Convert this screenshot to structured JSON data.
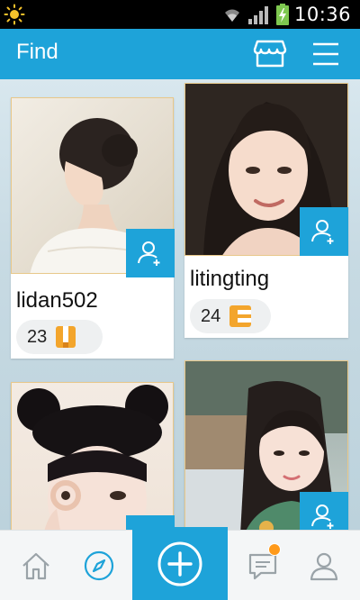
{
  "status_bar": {
    "time": "10:36"
  },
  "header": {
    "title": "Find"
  },
  "cards": [
    {
      "name": "lidan502",
      "count": "23"
    },
    {
      "name": "litingting",
      "count": "24"
    },
    {
      "name": "",
      "count": ""
    },
    {
      "name": "",
      "count": ""
    }
  ],
  "bottom_nav": {
    "items": [
      "home-icon",
      "compass-icon",
      "add-icon",
      "chat-icon",
      "profile-icon"
    ],
    "chat_has_notification": true
  },
  "colors": {
    "accent": "#1ea3d9",
    "badge": "#ff9a1a",
    "background": "#c9dbe3"
  }
}
